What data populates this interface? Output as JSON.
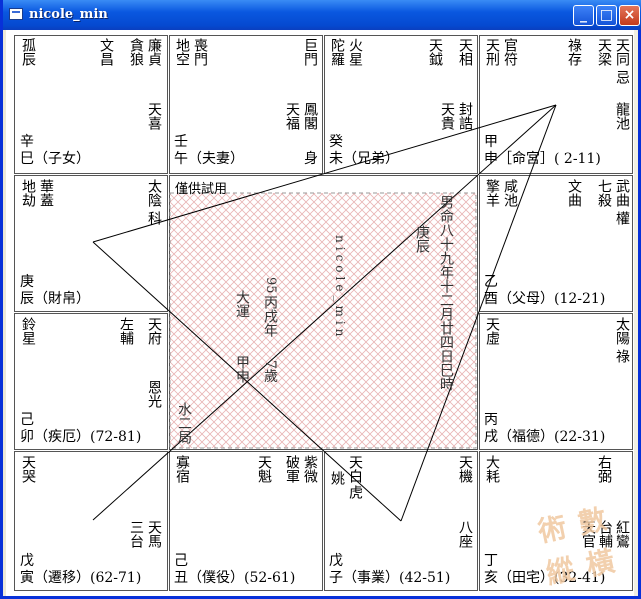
{
  "window": {
    "title": "nicole_min"
  },
  "center": {
    "header": "僅供試用",
    "name": "nicole_min",
    "lunar": "男命八十九年十二月廿四日巳時",
    "year_branch": "庚辰",
    "age": "95",
    "current_year": "丙戌年",
    "age_years": "7歲",
    "major_label": "大運",
    "major_gz": "甲申",
    "element": "水二局"
  },
  "palaces": {
    "si": {
      "stars": [
        "孤辰",
        "文昌",
        "貪狼",
        "廉貞"
      ],
      "stars2": [
        "天喜"
      ],
      "stem": "辛",
      "branch": "巳（子女）"
    },
    "wu": {
      "stars": [
        "地空",
        "喪門"
      ],
      "right": [
        "巨門"
      ],
      "stars2": [
        "天福",
        "鳳閣"
      ],
      "stem": "壬",
      "branch": "午（夫妻）",
      "extra": "身"
    },
    "wei": {
      "stars": [
        "陀羅",
        "火星"
      ],
      "right": [
        "天鉞",
        "天相"
      ],
      "stars2": [
        "天貴",
        "封誥"
      ],
      "stem": "癸",
      "branch": "未（兄弟）"
    },
    "shen": {
      "stars": [
        "天刑",
        "官符"
      ],
      "right": [
        "祿存",
        "天梁",
        "天同",
        "忌"
      ],
      "stars2": [
        "龍池"
      ],
      "stem": "甲",
      "branch": "申［命宮］( 2-11)"
    },
    "chen": {
      "stars": [
        "地劫",
        "華蓋"
      ],
      "right": [
        "太陰",
        "科"
      ],
      "stem": "庚",
      "branch": "辰（財帛）"
    },
    "you": {
      "stars": [
        "擎羊",
        "咸池"
      ],
      "right": [
        "文曲",
        "七殺",
        "武曲",
        "權"
      ],
      "stem": "乙",
      "branch": "酉（父母）(12-21)"
    },
    "mao": {
      "stars": [
        "鈴星"
      ],
      "right": [
        "左輔",
        "天府"
      ],
      "stars2": [
        "恩光"
      ],
      "stem": "己",
      "branch": "卯（疾厄）(72-81)"
    },
    "xu": {
      "stars": [
        "天虛"
      ],
      "right": [
        "太陽",
        "祿"
      ],
      "stem": "丙",
      "branch": "戌（福德）(22-31)"
    },
    "yin": {
      "stars": [
        "天哭"
      ],
      "stars2": [
        "三台",
        "天馬"
      ],
      "stem": "戊",
      "branch": "寅（遷移）(62-71)"
    },
    "chou": {
      "stars": [
        "寡宿"
      ],
      "right": [
        "天魁",
        "破軍",
        "紫微"
      ],
      "stem": "己",
      "branch": "丑（僕役）(52-61)"
    },
    "zi": {
      "stars": [
        "姚",
        "天白",
        "虎"
      ],
      "right": [
        "天機"
      ],
      "stars2": [
        "八座"
      ],
      "stem": "戊",
      "branch": "子（事業）(42-51)"
    },
    "hai": {
      "stars": [
        "大耗"
      ],
      "right": [
        "右弼"
      ],
      "stars2": [
        "天官",
        "台輔",
        "紅鸞"
      ],
      "stem": "丁",
      "branch": "亥（田宅）(32-41)"
    }
  },
  "watermark": [
    "術",
    "數",
    "縱",
    "橫"
  ]
}
